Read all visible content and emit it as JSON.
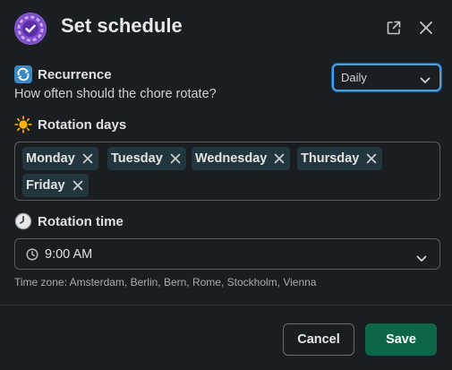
{
  "header": {
    "title": "Set schedule",
    "logo_icon": "chore-app-logo",
    "actions": [
      "external-link-icon",
      "close-icon"
    ]
  },
  "recurrence": {
    "emoji": "repeat-arrows",
    "label": "Recurrence",
    "help": "How often should the chore rotate?",
    "selected": "Daily"
  },
  "rotation_days": {
    "emoji": "sun",
    "label": "Rotation days",
    "chips": [
      "Monday",
      "Tuesday",
      "Wednesday",
      "Thursday",
      "Friday"
    ]
  },
  "rotation_time": {
    "emoji": "clock",
    "label": "Rotation time",
    "selected": "9:00 AM",
    "timezone": "Time zone: Amsterdam, Berlin, Bern, Rome, Stockholm, Vienna"
  },
  "footer": {
    "cancel_label": "Cancel",
    "save_label": "Save"
  },
  "colors": {
    "background": "#1a1d21",
    "accent_focus": "#1264a3",
    "save_button": "#0b6748",
    "chip_bg": "#23363d",
    "logo": "#8a5fd1"
  }
}
